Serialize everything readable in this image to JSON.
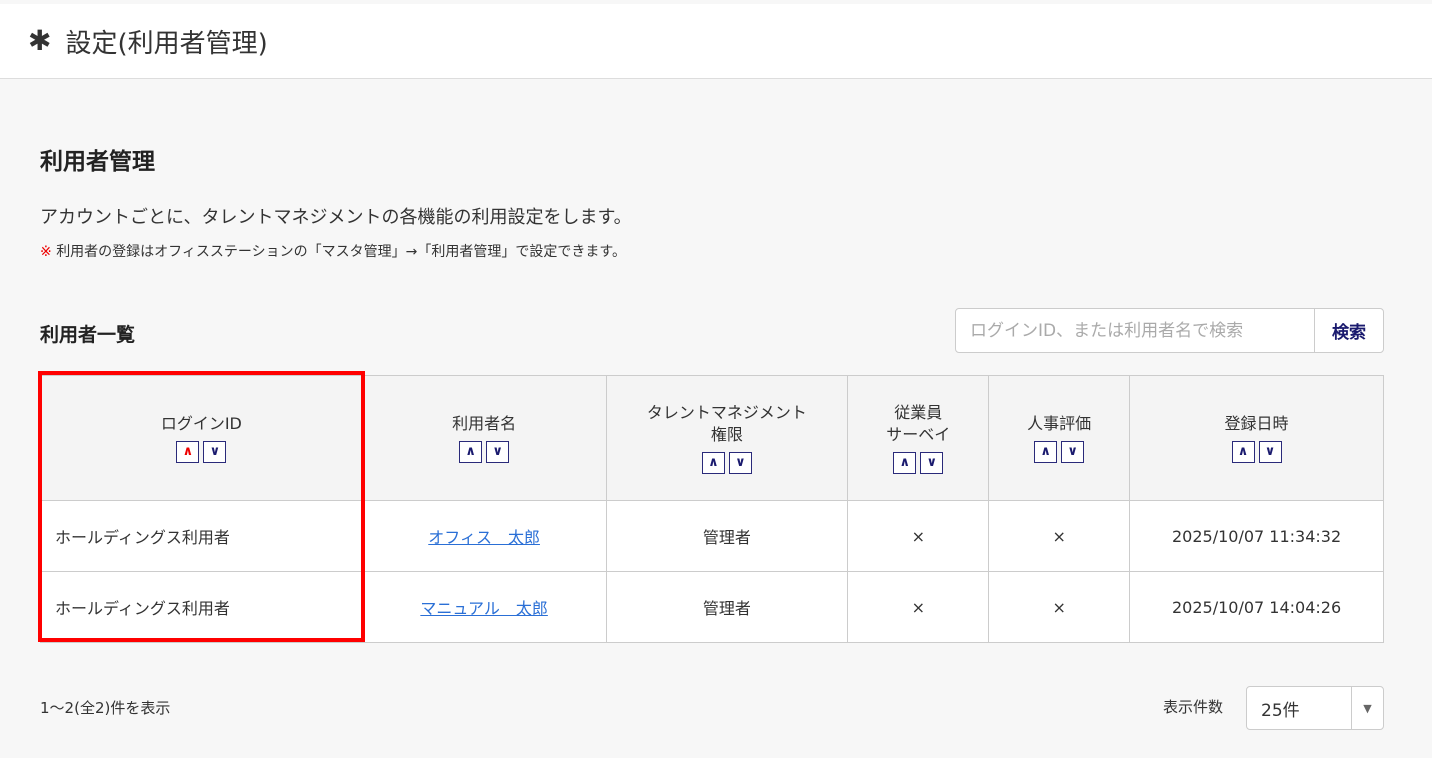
{
  "header": {
    "title": "設定(利用者管理)",
    "icon": "gear-icon"
  },
  "page": {
    "title": "利用者管理",
    "description": "アカウントごとに、タレントマネジメントの各機能の利用設定をします。",
    "note_mark": "※",
    "note": "利用者の登録はオフィスステーションの「マスタ管理」→「利用者管理」で設定できます。"
  },
  "list": {
    "title": "利用者一覧",
    "search_placeholder": "ログインID、または利用者名で検索",
    "search_button": "検索"
  },
  "table": {
    "columns": [
      "ログインID",
      "利用者名",
      "タレントマネジメント\n権限",
      "従業員\nサーベイ",
      "人事評価",
      "登録日時"
    ],
    "sort_up": "^",
    "sort_down": "v",
    "rows": [
      [
        "ホールディングス利用者",
        "オフィス　太郎",
        "管理者",
        "×",
        "×",
        "2025/10/07 11:34:32"
      ],
      [
        "ホールディングス利用者",
        "マニュアル　太郎",
        "管理者",
        "×",
        "×",
        "2025/10/07 14:04:26"
      ]
    ]
  },
  "footer": {
    "count": "1〜2(全2)件を表示",
    "per_page_label": "表示件数",
    "per_page_value": "25件"
  },
  "colors": {
    "highlight": "#ff0000",
    "sort_active": "#e00000",
    "link": "#2a6fd6"
  }
}
